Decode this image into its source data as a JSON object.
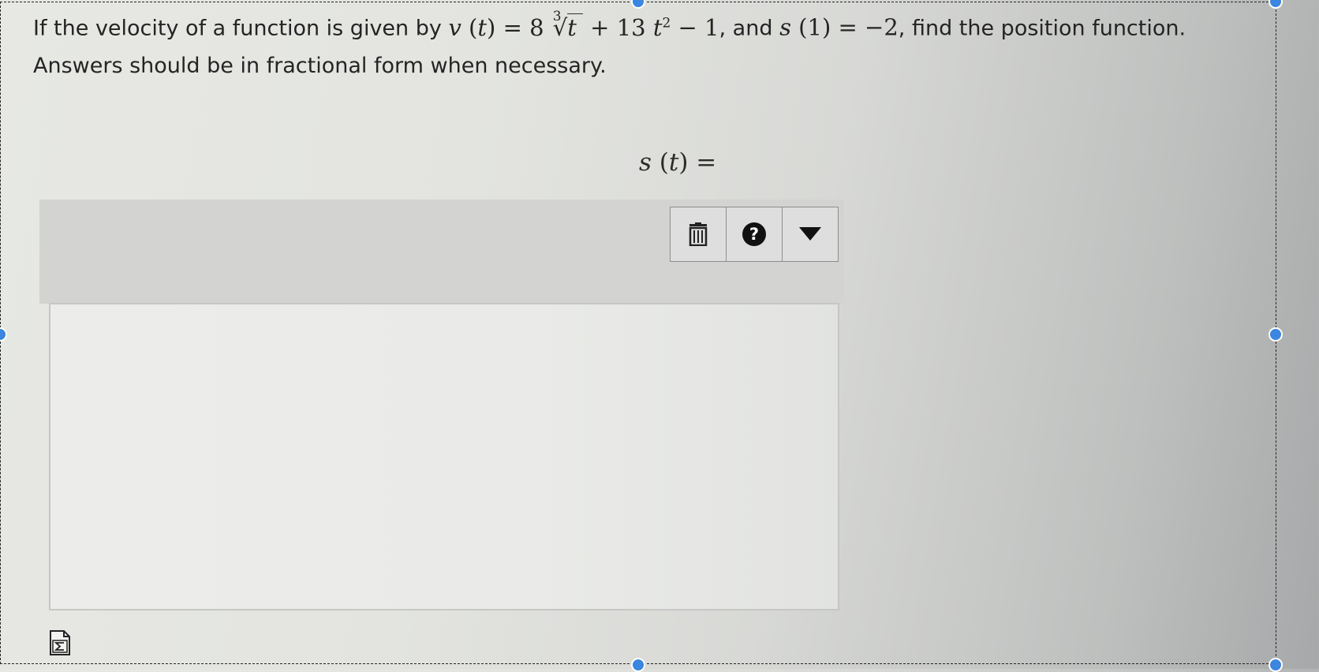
{
  "question": {
    "text_before": "If the velocity of a function is given by",
    "v_func": "v",
    "var": "t",
    "eq_sign": "=",
    "coef1": "8",
    "root_index": "3",
    "plus": "+",
    "coef2": "13",
    "exponent": "2",
    "minus": "−",
    "const": "1",
    "text_and": ", and",
    "s_func": "s",
    "s_arg": "1",
    "s_value": "−2",
    "text_after": ", find the position function.",
    "line2": "Answers should be in fractional form when necessary."
  },
  "answer": {
    "func": "s",
    "var": "t",
    "eq": "=",
    "value": ""
  },
  "toolbar": {
    "icons": [
      "trash-icon",
      "help-icon",
      "dropdown-icon"
    ],
    "help_glyph": "?"
  },
  "colors": {
    "handle": "#3a86e0",
    "toolbar_bg": "#d3d4d2",
    "answer_bg": "#ececea"
  }
}
